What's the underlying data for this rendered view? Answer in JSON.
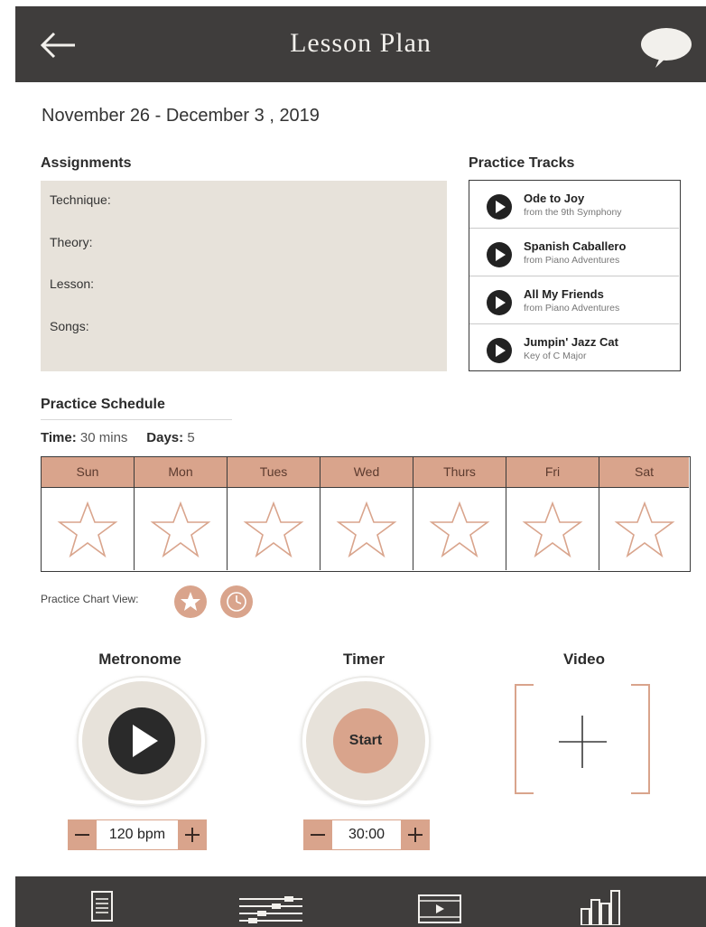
{
  "header": {
    "title": "Lesson Plan"
  },
  "date_range": "November 26 - December 3 , 2019",
  "assignments": {
    "title": "Assignments",
    "items": [
      "Technique:",
      "Theory:",
      "Lesson:",
      "Songs:"
    ]
  },
  "practice_tracks": {
    "title": "Practice Tracks",
    "tracks": [
      {
        "name": "Ode to Joy",
        "subtitle": "from the 9th Symphony"
      },
      {
        "name": "Spanish Caballero",
        "subtitle": "from Piano Adventures"
      },
      {
        "name": "All My Friends",
        "subtitle": "from Piano Adventures"
      },
      {
        "name": "Jumpin' Jazz Cat",
        "subtitle": "Key of C Major"
      }
    ]
  },
  "practice_schedule": {
    "title": "Practice Schedule",
    "time_label": "Time:",
    "time_value": "30 mins",
    "days_label": "Days:",
    "days_value": "5",
    "days": [
      "Sun",
      "Mon",
      "Tues",
      "Wed",
      "Thurs",
      "Fri",
      "Sat"
    ]
  },
  "chart_view": {
    "label": "Practice Chart View:"
  },
  "metronome": {
    "title": "Metronome",
    "value": "120 bpm"
  },
  "timer": {
    "title": "Timer",
    "start_label": "Start",
    "value": "30:00"
  },
  "video": {
    "title": "Video"
  },
  "colors": {
    "accent": "#d9a48c",
    "header_bg": "#3f3d3c",
    "panel_bg": "#e7e2da"
  },
  "bottom_nav": {
    "items": [
      {
        "icon": "document-list-icon"
      },
      {
        "icon": "sliders-icon"
      },
      {
        "icon": "video-film-icon"
      },
      {
        "icon": "bar-chart-icon"
      }
    ]
  }
}
